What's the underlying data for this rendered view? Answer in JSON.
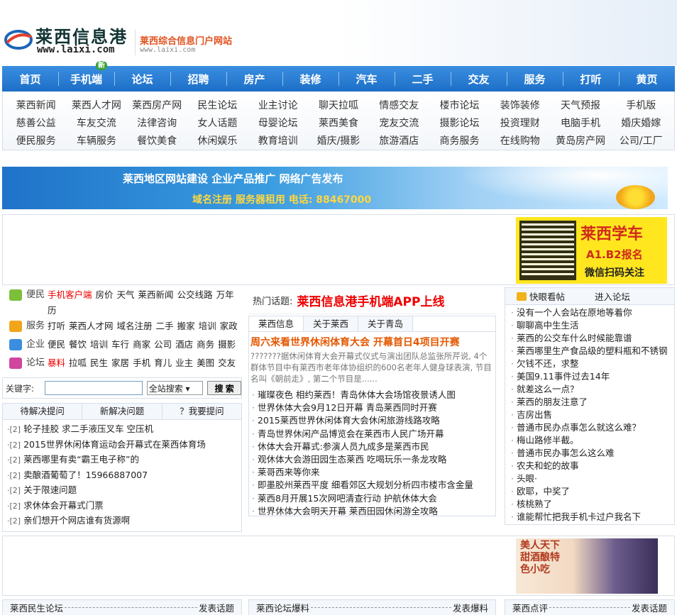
{
  "header": {
    "logo_name": "莱西信息港",
    "logo_url": "www.laixi.com",
    "slogan": "莱西综合信息门户网站",
    "slogan_url": "www.laixi.com"
  },
  "main_nav": {
    "items": [
      "首页",
      "手机端",
      "论坛",
      "招聘",
      "房产",
      "装修",
      "汽车",
      "二手",
      "交友",
      "服务",
      "打听",
      "黄页"
    ],
    "new_badge": "新"
  },
  "sub_nav": {
    "rows": [
      [
        "莱西新闻",
        "莱西人才网",
        "莱西房产网",
        "民生论坛",
        "业主讨论",
        "聊天拉呱",
        "情感交友",
        "楼市论坛",
        "装饰装修",
        "天气预报",
        "手机版"
      ],
      [
        "慈善公益",
        "车友交流",
        "法律咨询",
        "女人话题",
        "母婴论坛",
        "莱西美食",
        "宠友交流",
        "摄影论坛",
        "投资理财",
        "电脑手机",
        "婚庆婚嫁"
      ],
      [
        "便民服务",
        "车辆服务",
        "餐饮美食",
        "休闲娱乐",
        "教育培训",
        "婚庆/摄影",
        "旅游酒店",
        "商务服务",
        "在线购物",
        "黄岛房产网",
        "公司/工厂"
      ]
    ]
  },
  "banner": {
    "line1": "莱西地区网站建设  企业产品推广  网络广告发布",
    "line2": "域名注册  服务器租用  电话: 88467000"
  },
  "qr_ad": {
    "title": "莱西学车",
    "subtitle": "A1.B2报名",
    "scan": "微信扫码关注"
  },
  "services": [
    {
      "cat": "便民",
      "links": [
        {
          "t": "手机客户端",
          "red": true
        },
        {
          "t": "房价"
        },
        {
          "t": "天气"
        },
        {
          "t": "莱西新闻"
        },
        {
          "t": "公交线路"
        },
        {
          "t": "万年历"
        }
      ]
    },
    {
      "cat": "服务",
      "links": [
        {
          "t": "打听"
        },
        {
          "t": "莱西人才网"
        },
        {
          "t": "域名注册"
        },
        {
          "t": "二手"
        },
        {
          "t": "搬家"
        },
        {
          "t": "培训"
        },
        {
          "t": "家政"
        }
      ]
    },
    {
      "cat": "企业",
      "links": [
        {
          "t": "便民"
        },
        {
          "t": "餐饮"
        },
        {
          "t": "培训"
        },
        {
          "t": "车行"
        },
        {
          "t": "商家"
        },
        {
          "t": "公司"
        },
        {
          "t": "酒店"
        },
        {
          "t": "商务"
        },
        {
          "t": "摄影"
        }
      ]
    },
    {
      "cat": "论坛",
      "links": [
        {
          "t": "暴料",
          "red": true
        },
        {
          "t": "拉呱"
        },
        {
          "t": "民生"
        },
        {
          "t": "家居"
        },
        {
          "t": "手机"
        },
        {
          "t": "育儿"
        },
        {
          "t": "业主"
        },
        {
          "t": "美图"
        },
        {
          "t": "交友"
        }
      ]
    }
  ],
  "search": {
    "label": "关键字:",
    "value": "",
    "scope": "全站搜索 ▾",
    "button": "搜 索"
  },
  "qa": {
    "tabs": [
      "待解决提问",
      "新解决问题",
      "？我要提问"
    ],
    "items": [
      {
        "cnt": "·[2]",
        "t": "轮子挂胶 求二手液压叉车 空压机"
      },
      {
        "cnt": "·[2]",
        "t": "2015世界休闲体育运动会开幕式在莱西体育场"
      },
      {
        "cnt": "·[2]",
        "t": "莱西哪里有卖“霸王电子称”的"
      },
      {
        "cnt": "·[2]",
        "t": "卖酿酒葡萄了！15966887007"
      },
      {
        "cnt": "·[2]",
        "t": "关于限速问题"
      },
      {
        "cnt": "·[2]",
        "t": "求休体会开幕式门票"
      },
      {
        "cnt": "·[2]",
        "t": "亲们想开个网店谁有货源啊"
      }
    ]
  },
  "hot_topic": {
    "label": "热门话题:",
    "text": "莱西信息港手机端APP上线"
  },
  "news": {
    "tabs": [
      "莱西信息",
      "关于莱西",
      "关于青岛"
    ],
    "headline": "周六来看世界休闲体育大会  开幕首日4项目开赛",
    "summary": "???????据休闲体育大会开幕式仪式与演出团队总监张所芹说, 4个群体节目中有莱西市老年体协组织的600名老年人健身球表演, 节目名叫《朝前走》, 第二个节目是......",
    "items": [
      "璀璨夜色  相约莱西！青岛休体大会场馆夜景诱人图",
      "世界休体大会9月12日开幕  青岛莱西同时开赛",
      "2015莱西世界休闲体育大会休闲旅游线路攻略",
      "青岛世界休闲产品博览会在莱西市人民广场开幕",
      "休体大会开幕式:参演人员九成多是莱西市民",
      "观休体大会游田园生态莱西  吃喝玩乐一条龙攻略",
      "莱哥西来等你来",
      "即墨胶州莱西平度  细看郊区大规划分析四市楼市含金量",
      "莱西8月开展15次网吧清查行动  护航休体大会",
      "世界休体大会明天开幕  莱西田园休闲游全攻略"
    ]
  },
  "forum": {
    "title": "快眼看帖",
    "enter": "进入论坛",
    "items": [
      "没有一个人会站在原地等着你",
      "聊聊高中生生活",
      "莱西的公交车什么时候能靠谱",
      "莱西哪里生产食品级的塑料瓶和不锈钢",
      "欠钱不还，求整",
      "美国9.11事件过去14年",
      "就差这么一点？",
      "莱西的朋友注意了",
      "吉房出售",
      "普通市民办点事怎么就这么难？",
      "梅山路修半截。",
      "普通市民办事怎么这么难",
      "农夫和蛇的故事",
      "头眼·",
      "欧耶，中奖了",
      "核桃熟了",
      "谁能帮忙把我手机卡过户我名下"
    ]
  },
  "food_ad": {
    "text": "美人天下甜酒酿特色小吃"
  },
  "bottom_bars": [
    {
      "left": "莱西民生论坛",
      "right": "发表话题"
    },
    {
      "left": "莱西论坛爆料",
      "right": "发表爆料"
    },
    {
      "left": "莱西点评",
      "right": "发表话题"
    }
  ]
}
